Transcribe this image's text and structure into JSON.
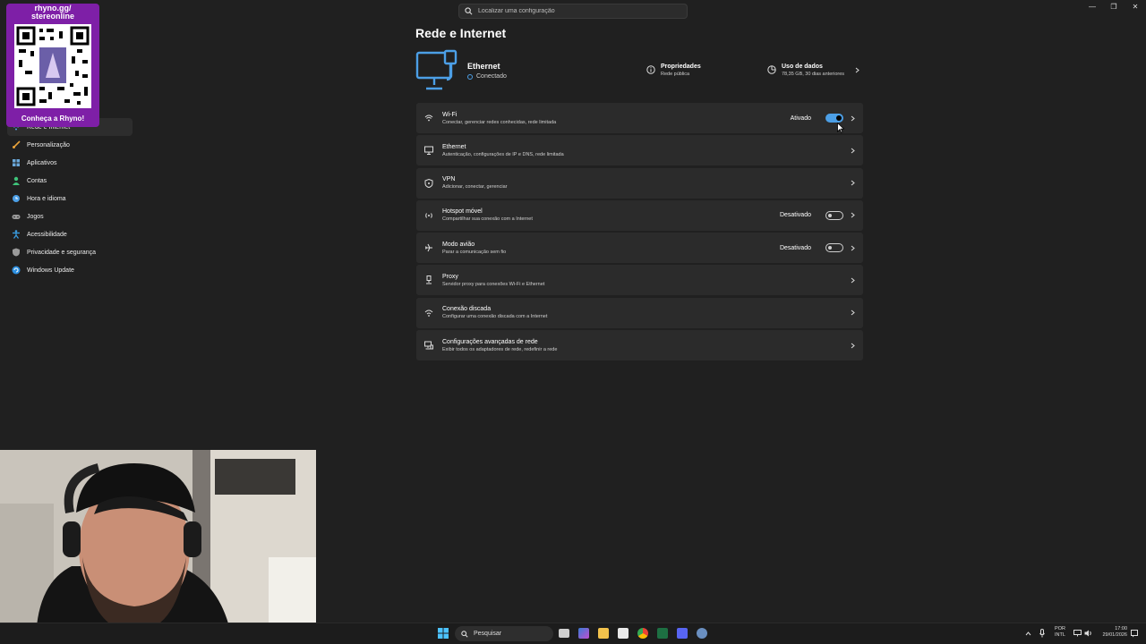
{
  "search": {
    "placeholder": "Localizar uma configuração"
  },
  "promo": {
    "url_line1": "rhyno.gg/",
    "url_line2": "stereonline",
    "cta": "Conheça a Rhyno!"
  },
  "sidebar": {
    "items": [
      {
        "label": "Rede e Internet",
        "icon": "wifi-icon",
        "color": "#4c9fe6",
        "active": true
      },
      {
        "label": "Personalização",
        "icon": "brush-icon",
        "color": "#e8a23a",
        "active": false
      },
      {
        "label": "Aplicativos",
        "icon": "apps-icon",
        "color": "#6aa7d9",
        "active": false
      },
      {
        "label": "Contas",
        "icon": "person-icon",
        "color": "#3fc47a",
        "active": false
      },
      {
        "label": "Hora e idioma",
        "icon": "globe-clock-icon",
        "color": "#4c9fe6",
        "active": false
      },
      {
        "label": "Jogos",
        "icon": "gamepad-icon",
        "color": "#9a9a9a",
        "active": false
      },
      {
        "label": "Acessibilidade",
        "icon": "accessibility-icon",
        "color": "#3aa0e6",
        "active": false
      },
      {
        "label": "Privacidade e segurança",
        "icon": "shield-icon",
        "color": "#9a9a9a",
        "active": false
      },
      {
        "label": "Windows Update",
        "icon": "update-icon",
        "color": "#2c8fe0",
        "active": false
      }
    ]
  },
  "page": {
    "title": "Rede e Internet"
  },
  "hero": {
    "title": "Ethernet",
    "status": "Conectado",
    "properties_title": "Propriedades",
    "properties_sub": "Rede pública",
    "data_title": "Uso de dados",
    "data_sub": "78,35 GB, 30 dias anteriores"
  },
  "cards": [
    {
      "title": "Wi-Fi",
      "sub": "Conectar, gerenciar redes conhecidas, rede limitada",
      "state": "Ativado",
      "toggle": "on",
      "icon": "wifi-icon"
    },
    {
      "title": "Ethernet",
      "sub": "Autenticação, configurações de IP e DNS, rede limitada",
      "state": "",
      "toggle": "",
      "icon": "ethernet-icon"
    },
    {
      "title": "VPN",
      "sub": "Adicionar, conectar, gerenciar",
      "state": "",
      "toggle": "",
      "icon": "vpn-shield-icon"
    },
    {
      "title": "Hotspot móvel",
      "sub": "Compartilhar sua conexão com a Internet",
      "state": "Desativado",
      "toggle": "off",
      "icon": "hotspot-icon"
    },
    {
      "title": "Modo avião",
      "sub": "Parar a comunicação sem fio",
      "state": "Desativado",
      "toggle": "off",
      "icon": "airplane-icon"
    },
    {
      "title": "Proxy",
      "sub": "Servidor proxy para conexões Wi-Fi e Ethernet",
      "state": "",
      "toggle": "",
      "icon": "proxy-icon"
    },
    {
      "title": "Conexão discada",
      "sub": "Configurar uma conexão discada com a Internet",
      "state": "",
      "toggle": "",
      "icon": "dialup-icon"
    },
    {
      "title": "Configurações avançadas de rede",
      "sub": "Exibir todos os adaptadores de rede, redefinir a rede",
      "state": "",
      "toggle": "",
      "icon": "network-adapter-icon"
    }
  ],
  "taskbar": {
    "search_label": "Pesquisar",
    "lang_line1": "POR",
    "lang_line2": "INTL",
    "time": "17:00",
    "date": "29/01/2026"
  }
}
